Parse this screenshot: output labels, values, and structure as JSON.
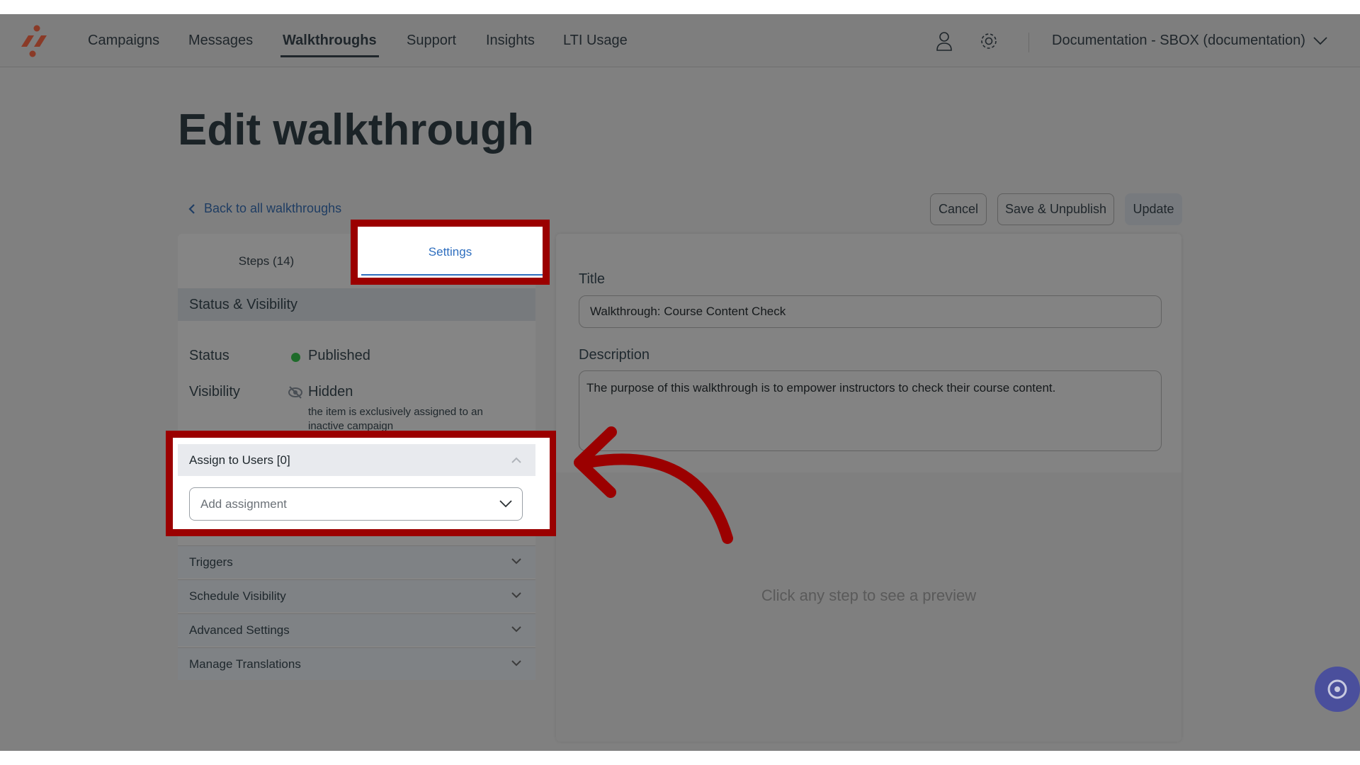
{
  "nav": {
    "items": [
      "Campaigns",
      "Messages",
      "Walkthroughs",
      "Support",
      "Insights",
      "LTI Usage"
    ],
    "active": "Walkthroughs",
    "account": "Documentation - SBOX (documentation)",
    "icons": [
      "user-icon",
      "gear-icon",
      "chevron-down-icon"
    ]
  },
  "page": {
    "title": "Edit walkthrough",
    "back_link": "Back to all walkthroughs"
  },
  "actions": {
    "cancel": "Cancel",
    "save_unpublish": "Save & Unpublish",
    "update": "Update"
  },
  "tabs": {
    "steps": "Steps (14)",
    "settings": "Settings",
    "active": "Settings"
  },
  "status_section": {
    "header": "Status & Visibility",
    "status_label": "Status",
    "status_value": "Published",
    "status_color": "#1e6b2a",
    "visibility_label": "Visibility",
    "visibility_value": "Hidden",
    "visibility_note": "the item is exclusively assigned to an inactive campaign"
  },
  "assign": {
    "header": "Assign to Users [0]",
    "placeholder": "Add assignment"
  },
  "accordions": [
    "Triggers",
    "Schedule Visibility",
    "Advanced Settings",
    "Manage Translations"
  ],
  "form": {
    "title_label": "Title",
    "title_value": "Walkthrough: Course Content Check",
    "description_label": "Description",
    "description_value": "The purpose of this walkthrough is to empower instructors to check their course content."
  },
  "preview": {
    "empty_text": "Click any step to see a preview"
  },
  "colors": {
    "highlight": "#9b0000",
    "accent": "#2f6fbf"
  }
}
